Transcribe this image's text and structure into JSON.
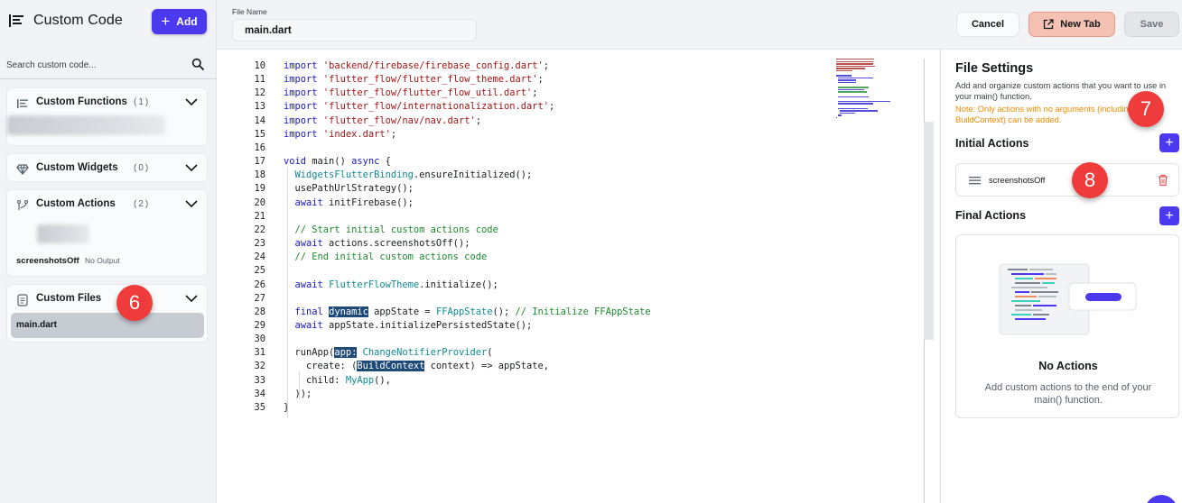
{
  "sidebar": {
    "title": "Custom Code",
    "add_label": "Add",
    "search_placeholder": "Search custom code...",
    "sections": [
      {
        "title": "Custom Functions",
        "count": "(1)"
      },
      {
        "title": "Custom Widgets",
        "count": "(0)"
      },
      {
        "title": "Custom Actions",
        "count": "(2)",
        "items": [
          {
            "name": "screenshotsOff",
            "status": "No Output"
          }
        ]
      },
      {
        "title": "Custom Files",
        "items": [
          {
            "name": "main.dart"
          }
        ]
      }
    ]
  },
  "badges": [
    "6",
    "7",
    "8"
  ],
  "topbar": {
    "file_name_label": "File Name",
    "file_name": "main.dart",
    "cancel_label": "Cancel",
    "new_tab_label": "New Tab",
    "save_label": "Save"
  },
  "editor": {
    "lines": [
      {
        "n": "10",
        "t": "import 'backend/firebase/firebase_config.dart';"
      },
      {
        "n": "11",
        "t": "import 'flutter_flow/flutter_flow_theme.dart';"
      },
      {
        "n": "12",
        "t": "import 'flutter_flow/flutter_flow_util.dart';"
      },
      {
        "n": "13",
        "t": "import 'flutter_flow/internationalization.dart';"
      },
      {
        "n": "14",
        "t": "import 'flutter_flow/nav/nav.dart';"
      },
      {
        "n": "15",
        "t": "import 'index.dart';"
      },
      {
        "n": "16",
        "t": ""
      },
      {
        "n": "17",
        "t": "void main() async {"
      },
      {
        "n": "18",
        "t": "  WidgetsFlutterBinding.ensureInitialized();"
      },
      {
        "n": "19",
        "t": "  usePathUrlStrategy();"
      },
      {
        "n": "20",
        "t": "  await initFirebase();"
      },
      {
        "n": "21",
        "t": ""
      },
      {
        "n": "22",
        "t": "  // Start initial custom actions code"
      },
      {
        "n": "23",
        "t": "  await actions.screenshotsOff();"
      },
      {
        "n": "24",
        "t": "  // End initial custom actions code"
      },
      {
        "n": "25",
        "t": ""
      },
      {
        "n": "26",
        "t": "  await FlutterFlowTheme.initialize();"
      },
      {
        "n": "27",
        "t": ""
      },
      {
        "n": "28",
        "t": "  final dynamic appState = FFAppState(); // Initialize FFAppState"
      },
      {
        "n": "29",
        "t": "  await appState.initializePersistedState();"
      },
      {
        "n": "30",
        "t": ""
      },
      {
        "n": "31",
        "t": "  runApp(app: ChangeNotifierProvider("
      },
      {
        "n": "32",
        "t": "    create: (BuildContext context) => appState,"
      },
      {
        "n": "33",
        "t": "    child: MyApp(),"
      },
      {
        "n": "34",
        "t": "  ));"
      },
      {
        "n": "35",
        "t": "}"
      }
    ]
  },
  "file_settings": {
    "title": "File Settings",
    "description": "Add and organize custom actions that you want to use in your main() function.",
    "note": "Note: Only actions with no arguments (including BuildContext) can be added.",
    "initial_actions_title": "Initial Actions",
    "initial_actions": [
      {
        "name": "screenshotsOff"
      }
    ],
    "final_actions_title": "Final Actions",
    "empty_title": "No Actions",
    "empty_desc": "Add custom actions to the end of your main() function."
  },
  "colors": {
    "accent": "#4b39ef",
    "badge": "#ef3b3b",
    "note": "#ee8b00",
    "new_tab_bg": "#f4c1b3"
  }
}
